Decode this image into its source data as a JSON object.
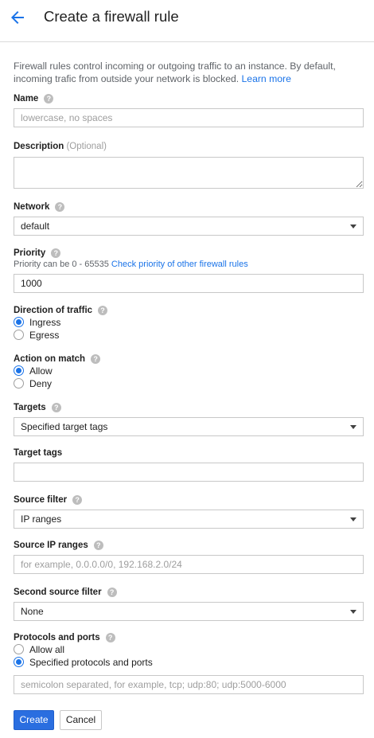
{
  "header": {
    "title": "Create a firewall rule"
  },
  "intro": {
    "text": "Firewall rules control incoming or outgoing traffic to an instance. By default, incoming trafic from outside your network is blocked.",
    "link": "Learn more"
  },
  "name": {
    "label": "Name",
    "placeholder": "lowercase, no spaces",
    "value": ""
  },
  "description": {
    "label": "Description",
    "optional": "(Optional)",
    "value": ""
  },
  "network": {
    "label": "Network",
    "selected": "default"
  },
  "priority": {
    "label": "Priority",
    "hint": "Priority can be 0 - 65535",
    "hint_link": "Check priority of other firewall rules",
    "value": "1000"
  },
  "direction": {
    "label": "Direction of traffic",
    "options": [
      "Ingress",
      "Egress"
    ],
    "selected": "Ingress"
  },
  "action": {
    "label": "Action on match",
    "options": [
      "Allow",
      "Deny"
    ],
    "selected": "Allow"
  },
  "targets": {
    "label": "Targets",
    "selected": "Specified target tags"
  },
  "target_tags": {
    "label": "Target tags",
    "value": ""
  },
  "source_filter": {
    "label": "Source filter",
    "selected": "IP ranges"
  },
  "source_ip": {
    "label": "Source IP ranges",
    "placeholder": "for example, 0.0.0.0/0, 192.168.2.0/24",
    "value": ""
  },
  "second_source": {
    "label": "Second source filter",
    "selected": "None"
  },
  "protocols": {
    "label": "Protocols and ports",
    "options": [
      "Allow all",
      "Specified protocols and ports"
    ],
    "selected": "Specified protocols and ports",
    "placeholder": "semicolon separated, for example, tcp; udp:80; udp:5000-6000"
  },
  "buttons": {
    "create": "Create",
    "cancel": "Cancel"
  },
  "icons": {
    "back": "arrow-back-icon",
    "help": "help-icon",
    "dropdown": "dropdown-caret-icon"
  },
  "colors": {
    "accent": "#1a73e8",
    "primary_button": "#2a6ee0"
  }
}
